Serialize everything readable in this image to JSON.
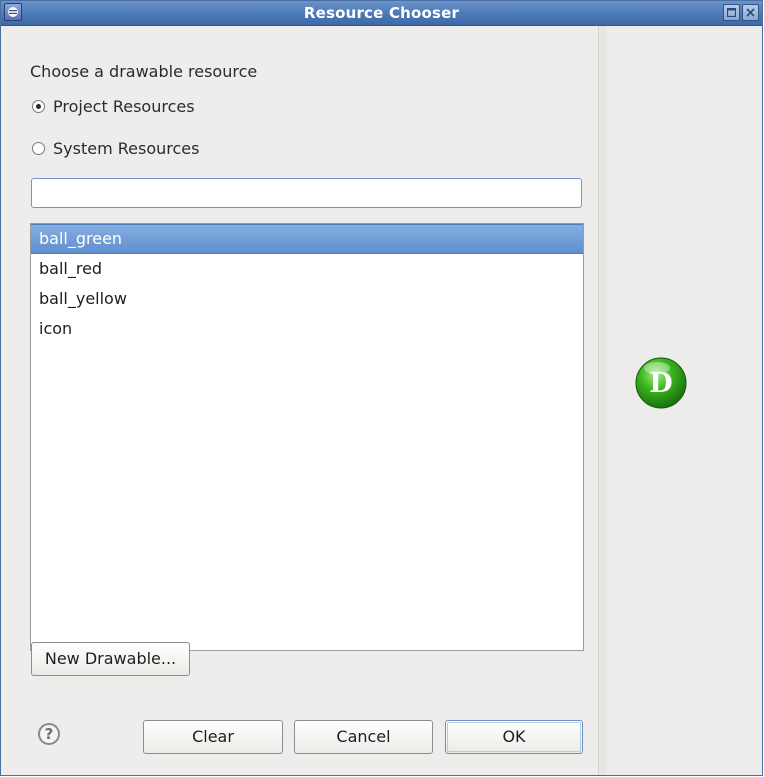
{
  "window": {
    "title": "Resource Chooser"
  },
  "chooser": {
    "prompt": "Choose a drawable resource",
    "radios": [
      {
        "label": "Project Resources",
        "selected": true
      },
      {
        "label": "System Resources",
        "selected": false
      }
    ],
    "filter": {
      "value": "",
      "placeholder": ""
    },
    "items": [
      {
        "label": "ball_green",
        "selected": true
      },
      {
        "label": "ball_red",
        "selected": false
      },
      {
        "label": "ball_yellow",
        "selected": false
      },
      {
        "label": "icon",
        "selected": false
      }
    ]
  },
  "buttons": {
    "new_drawable": "New Drawable...",
    "clear": "Clear",
    "cancel": "Cancel",
    "ok": "OK",
    "help_glyph": "?"
  },
  "preview": {
    "letter": "D",
    "icon": "green-ball-icon",
    "color": "#2fa71b"
  },
  "colors": {
    "titlebar": "#4b78b6",
    "selection": "#5f8fce"
  }
}
